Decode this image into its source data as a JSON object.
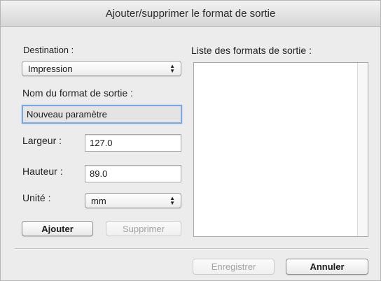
{
  "window": {
    "title": "Ajouter/supprimer le format de sortie"
  },
  "destination": {
    "label": "Destination :",
    "value": "Impression"
  },
  "output_format_name": {
    "label": "Nom du format de sortie :",
    "value": "Nouveau paramètre"
  },
  "width": {
    "label": "Largeur :",
    "value": "127.0"
  },
  "height": {
    "label": "Hauteur :",
    "value": "89.0"
  },
  "unit": {
    "label": "Unité :",
    "value": "mm"
  },
  "buttons": {
    "add": "Ajouter",
    "delete": "Supprimer",
    "save": "Enregistrer",
    "cancel": "Annuler"
  },
  "formats_list": {
    "label": "Liste des formats de sortie :",
    "items": []
  }
}
